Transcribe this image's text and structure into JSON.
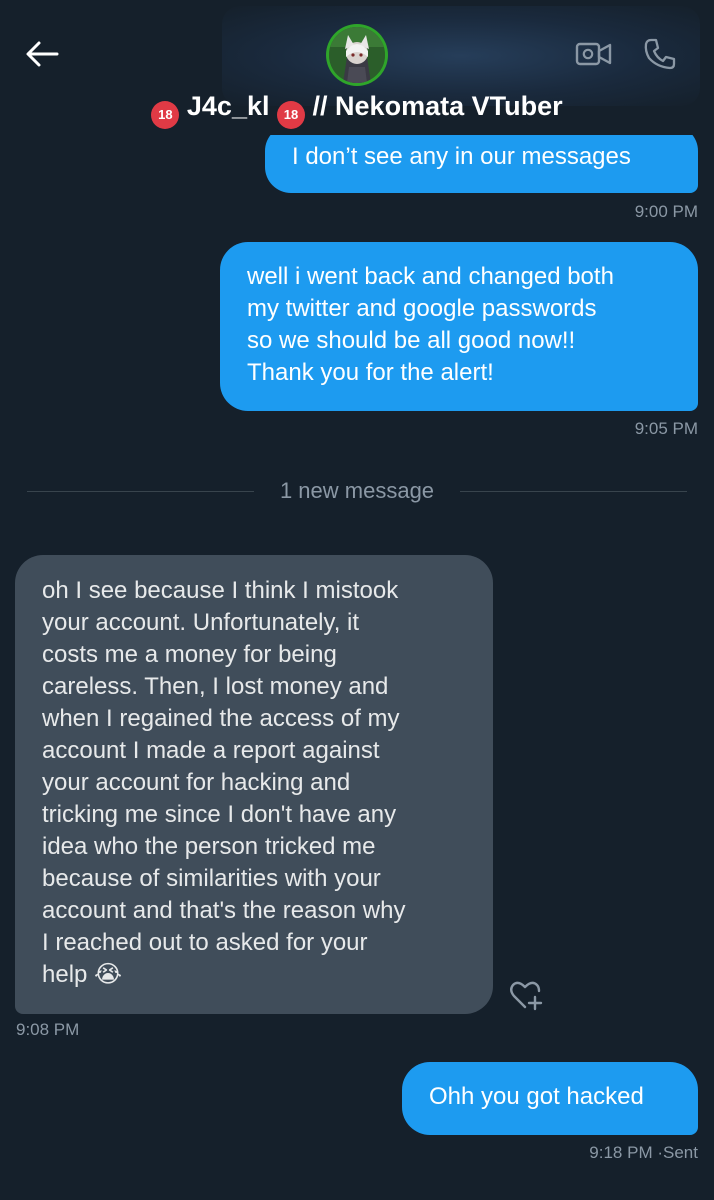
{
  "header": {
    "display_name": "J4c_kl",
    "separator": "//",
    "subtitle": "Nekomata VTuber",
    "badge_left": "18",
    "badge_right": "18",
    "icons": {
      "back": "back-arrow-icon",
      "video": "video-camera-icon",
      "call": "phone-icon"
    },
    "accent_online": "#2fa52a"
  },
  "colors": {
    "background": "#15202b",
    "outgoing_bubble": "#1d9bf0",
    "incoming_bubble": "#404d5a",
    "timestamp": "#8b98a5"
  },
  "messages": [
    {
      "direction": "outgoing",
      "text": "I don’t see any in our messages",
      "time": "9:00 PM"
    },
    {
      "direction": "outgoing",
      "lines": [
        "well i went back and changed both",
        "my twitter and google passwords",
        "so we should be all good now!!",
        "Thank you for the alert!"
      ],
      "time": "9:05 PM"
    },
    {
      "direction": "incoming",
      "lines": [
        "oh I see because I think I mistook",
        "your account. Unfortunately, it",
        "costs me a money for being",
        "careless. Then, I lost money and",
        "when I regained the access of my",
        "account I made a report against",
        "your account for hacking and",
        "tricking me since I don't have any",
        "idea who the person tricked me",
        "because of similarities with your",
        "account and that's the reason why",
        "I reached out to asked for your",
        "help 😭"
      ],
      "time": "9:08 PM"
    },
    {
      "direction": "outgoing",
      "text": "Ohh you got hacked",
      "time": "9:18 PM",
      "status": "Sent",
      "status_separator": "·"
    }
  ],
  "new_message_divider": "1 new message",
  "reaction_button_icon": "heart-plus-icon"
}
